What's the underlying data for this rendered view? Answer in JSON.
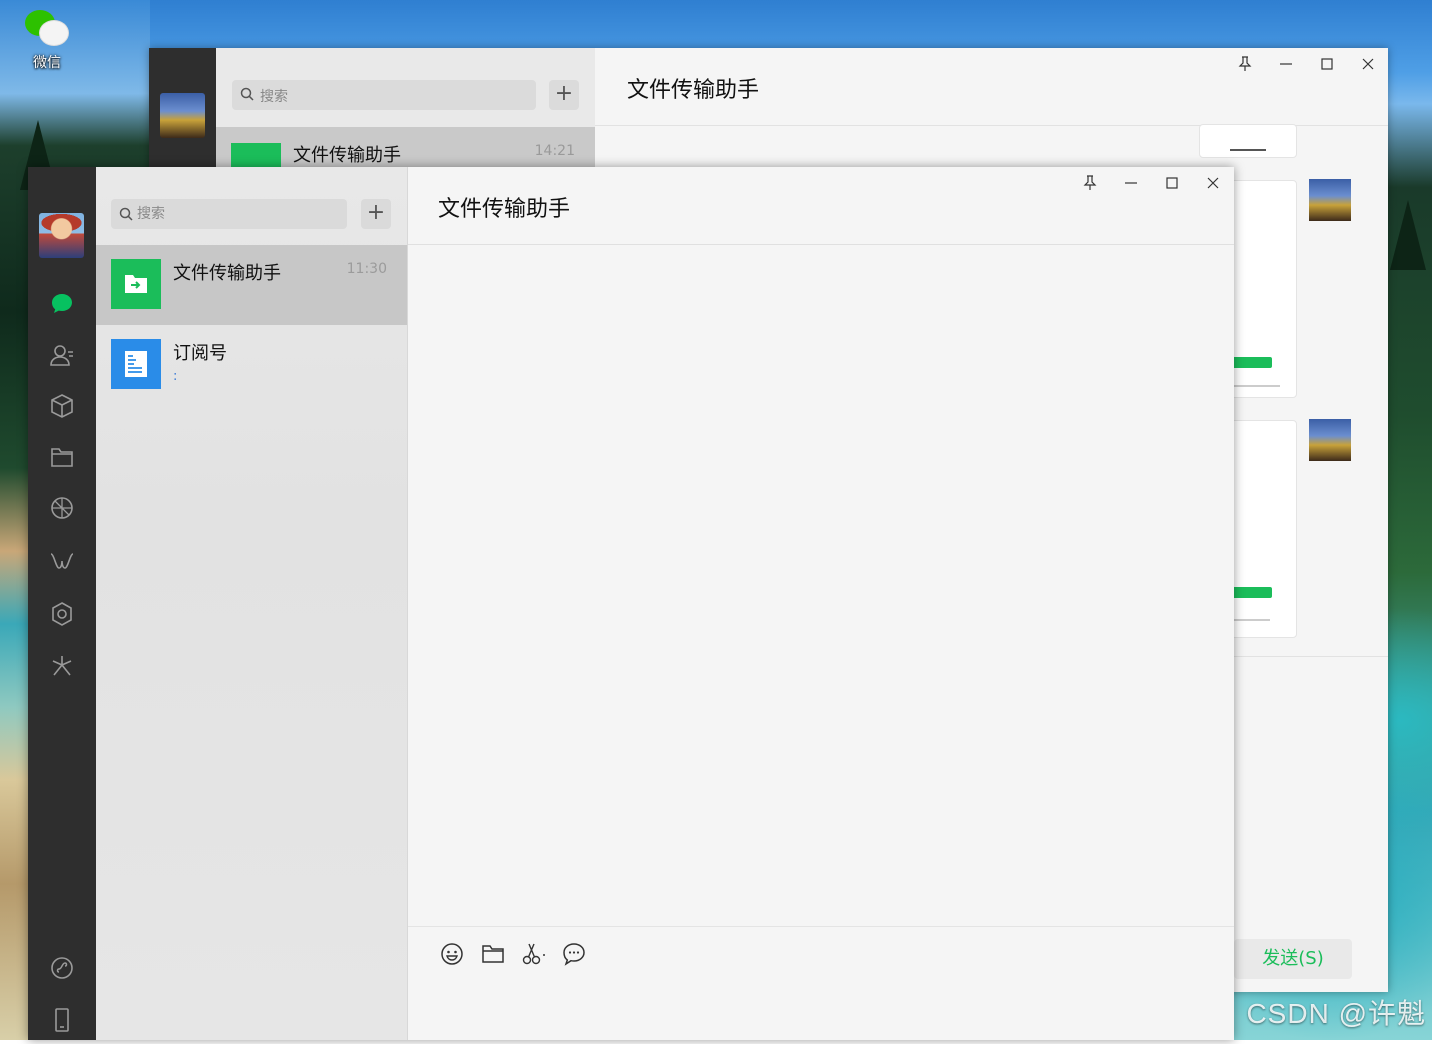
{
  "desktop": {
    "icon_label": "微信",
    "watermark": "CSDN @许魁"
  },
  "back_window": {
    "search_placeholder": "搜索",
    "plus_label": "+",
    "chat_item": {
      "name": "文件传输助手",
      "time": "14:21"
    },
    "title": "文件传输助手",
    "send_label": "发送(S)",
    "controls": {
      "pin": "⊥",
      "minimize": "—",
      "maximize": "☐",
      "close": "✕"
    }
  },
  "front_window": {
    "search_placeholder": "搜索",
    "plus_label": "+",
    "title": "文件传输助手",
    "controls": {
      "pin": "⊥",
      "minimize": "—",
      "maximize": "☐",
      "close": "✕"
    },
    "chats": [
      {
        "name": "文件传输助手",
        "time": "11:30",
        "preview": "",
        "icon": "file-transfer-icon",
        "color": "#1bbd5a"
      },
      {
        "name": "订阅号",
        "time": "",
        "preview": ":",
        "icon": "subscription-icon",
        "color": "#2a8ce8"
      }
    ],
    "nav_icons": [
      "chat-icon",
      "contacts-icon",
      "favorites-icon",
      "files-icon",
      "moments-icon",
      "channels-icon",
      "mini-programs-icon",
      "search-icon",
      "mini-program-panel-icon",
      "phone-icon"
    ],
    "toolbar_icons": [
      "emoji-icon",
      "folder-icon",
      "scissors-icon",
      "chat-history-icon"
    ],
    "accent_color": "#07c160"
  }
}
